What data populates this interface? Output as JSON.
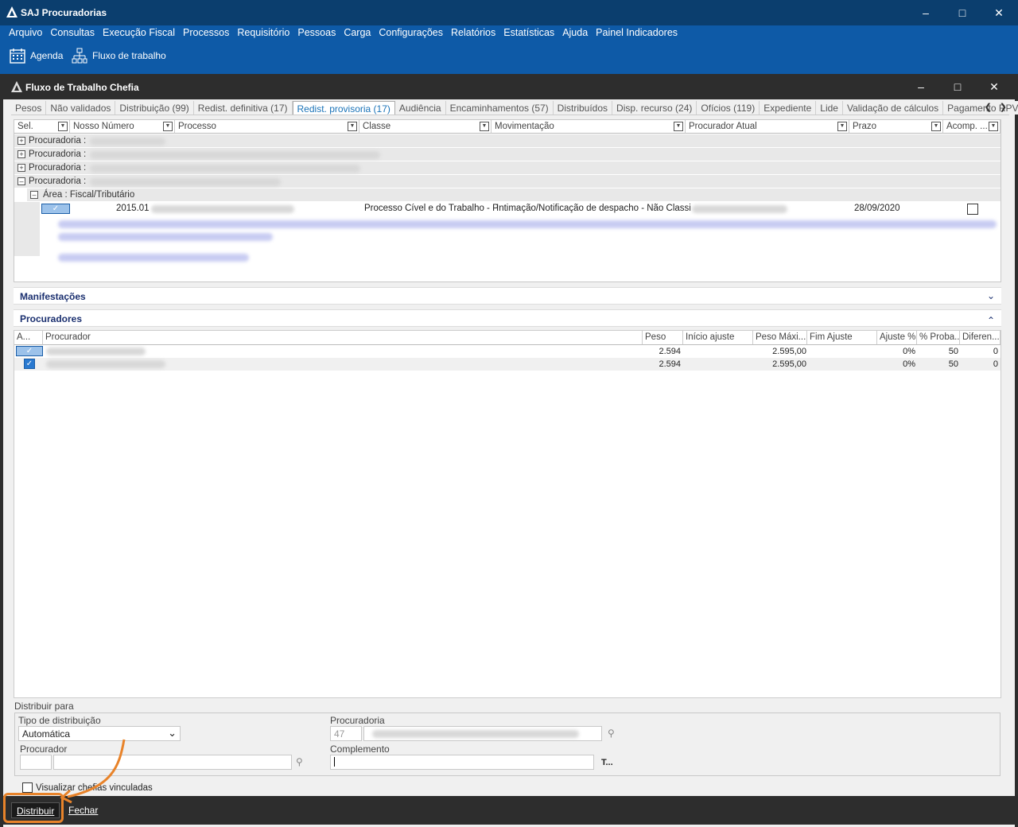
{
  "app": {
    "title": "SAJ Procuradorias"
  },
  "menu": [
    "Arquivo",
    "Consultas",
    "Execução Fiscal",
    "Processos",
    "Requisitório",
    "Pessoas",
    "Carga",
    "Configurações",
    "Relatórios",
    "Estatísticas",
    "Ajuda",
    "Painel Indicadores"
  ],
  "toolbar": {
    "agenda": "Agenda",
    "fluxo": "Fluxo de trabalho"
  },
  "child": {
    "title": "Fluxo de Trabalho Chefia"
  },
  "tabs": [
    "Pesos",
    "Não validados",
    "Distribuição (99)",
    "Redist. definitiva (17)",
    "Redist. provisoria (17)",
    "Audiência",
    "Encaminhamentos (57)",
    "Distribuídos",
    "Disp. recurso (24)",
    "Ofícios (119)",
    "Expediente",
    "Lide",
    "Validação de cálculos",
    "Pagamento RPV"
  ],
  "grid": {
    "columns": [
      "Sel.",
      "Nosso Número",
      "Processo",
      "Classe",
      "Movimentação",
      "Procurador Atual",
      "Prazo",
      "Acomp. ..."
    ],
    "groups": [
      "Procuradoria :",
      "Procuradoria :",
      "Procuradoria :",
      "Procuradoria :"
    ],
    "subgroup": "Área : Fiscal/Tributário",
    "row": {
      "numero": "2015.01",
      "classe": "Processo Cível e do Trabalho - P",
      "movimentacao": "Intimação/Notificação de despacho - Não Classi",
      "prazo": "28/09/2020"
    }
  },
  "sections": {
    "manifestacoes": "Manifestações",
    "procuradores": "Procuradores"
  },
  "proc_grid": {
    "columns": [
      "A...",
      "Procurador",
      "Peso",
      "Início ajuste",
      "Peso Máxi...",
      "Fim Ajuste",
      "Ajuste %",
      "% Proba...",
      "Diferen..."
    ],
    "rows": [
      {
        "peso": "2.594",
        "peso_max": "2.595,00",
        "ajuste": "0%",
        "prob": "50",
        "dif": "0"
      },
      {
        "peso": "2.594",
        "peso_max": "2.595,00",
        "ajuste": "0%",
        "prob": "50",
        "dif": "0"
      }
    ]
  },
  "distribuir": {
    "group_label": "Distribuir para",
    "tipo_label": "Tipo de distribuição",
    "tipo_value": "Automática",
    "procuradoria_label": "Procuradoria",
    "procuradoria_code": "47",
    "procurador_label": "Procurador",
    "complemento_label": "Complemento",
    "t_button": "T...",
    "chefias_label": "Visualizar chefias vinculadas"
  },
  "buttons": {
    "distribuir": "Distribuir",
    "fechar": "Fechar"
  },
  "colors": {
    "highlight": "#e8832a",
    "titlebar": "#0b3e6e",
    "menubar": "#0e5aa7"
  }
}
